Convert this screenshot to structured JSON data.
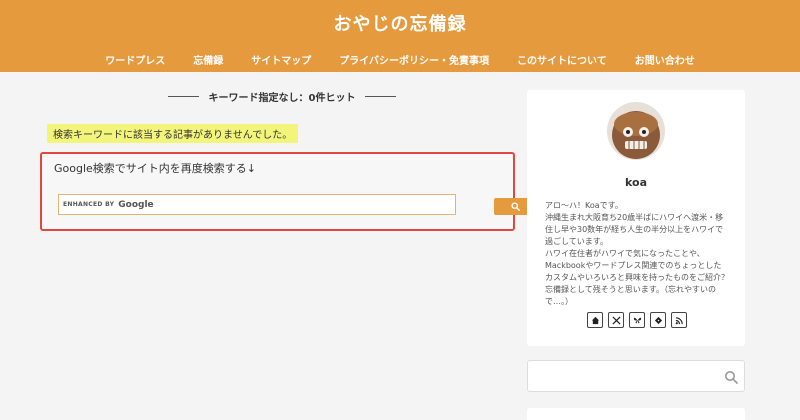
{
  "header": {
    "site_title": "おやじの忘備録",
    "nav": [
      "ワードプレス",
      "忘備録",
      "サイトマップ",
      "プライバシーポリシー・免責事項",
      "このサイトについて",
      "お問い合わせ"
    ]
  },
  "main": {
    "result_heading": "キーワード指定なし：0件ヒット",
    "no_match_message": "検索キーワードに該当する記事がありませんでした。",
    "search_box": {
      "title": "Google検索でサイト内を再度検索する↓",
      "enhanced_by": "ENHANCED BY",
      "google": "Google"
    }
  },
  "sidebar": {
    "profile": {
      "name": "koa",
      "bio": [
        "アロ〜ハ！Koaです。",
        "沖縄生まれ大阪育ち20歳半ばにハワイへ渡米・移住し早や30数年が経ち人生の半分以上をハワイで過ごしています。",
        "ハワイ在住者がハワイで気になったことや、Mackbookやワードプレス関連でのちょっとしたカスタムやいろいろと興味を持ったものをご紹介？忘備録として残そうと思います。（忘れやすいので…。）"
      ],
      "social_icons": [
        "home-icon",
        "x-icon",
        "bluesky-icon",
        "feedly-icon",
        "rss-icon"
      ]
    }
  },
  "colors": {
    "header": "#e69a3e",
    "highlight": "#f3f57a",
    "search_border": "#e0483f"
  }
}
